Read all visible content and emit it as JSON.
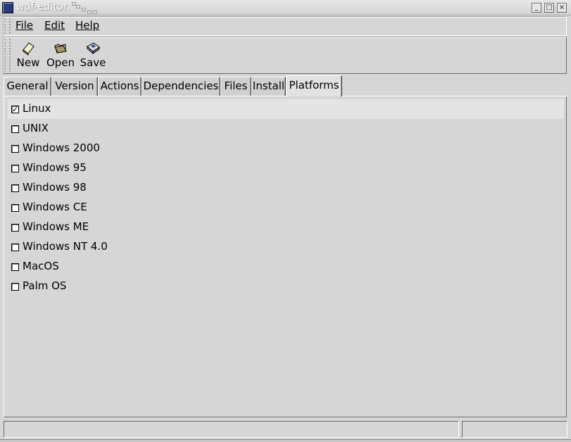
{
  "window": {
    "title": "wdf-editor",
    "controls": {
      "minimize": "_",
      "maximize": "□",
      "close": "×"
    }
  },
  "menubar": {
    "items": [
      {
        "label": "File"
      },
      {
        "label": "Edit"
      },
      {
        "label": "Help"
      }
    ]
  },
  "toolbar": {
    "buttons": [
      {
        "label": "New",
        "icon": "new-file-icon"
      },
      {
        "label": "Open",
        "icon": "open-folder-icon"
      },
      {
        "label": "Save",
        "icon": "save-disk-icon"
      }
    ]
  },
  "tabs": [
    {
      "label": "General"
    },
    {
      "label": "Version"
    },
    {
      "label": "Actions"
    },
    {
      "label": "Dependencies"
    },
    {
      "label": "Files"
    },
    {
      "label": "Install"
    },
    {
      "label": "Platforms",
      "active": true
    }
  ],
  "platforms": [
    {
      "label": "Linux",
      "checked": true
    },
    {
      "label": "UNIX",
      "checked": false
    },
    {
      "label": "Windows 2000",
      "checked": false
    },
    {
      "label": "Windows 95",
      "checked": false
    },
    {
      "label": "Windows 98",
      "checked": false
    },
    {
      "label": "Windows CE",
      "checked": false
    },
    {
      "label": "Windows ME",
      "checked": false
    },
    {
      "label": "Windows NT 4.0",
      "checked": false
    },
    {
      "label": "MacOS",
      "checked": false
    },
    {
      "label": "Palm OS",
      "checked": false
    }
  ],
  "statusbar": {
    "text": "",
    "right_text": ""
  }
}
